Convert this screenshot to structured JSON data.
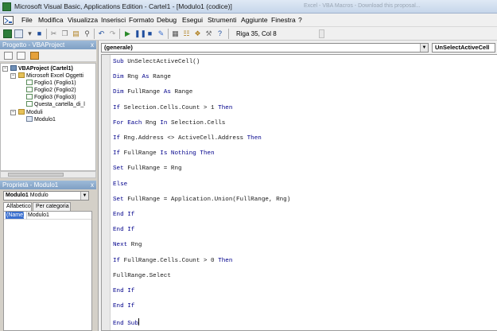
{
  "window": {
    "title": "Microsoft Visual Basic, Applications Edition - Cartel1 - [Modulo1 (codice)]",
    "ghost_title": "Excel - VBA Macros - Download this proposal..."
  },
  "menu": [
    "File",
    "Modifica",
    "Visualizza",
    "Inserisci",
    "Formato",
    "Debug",
    "Esegui",
    "Strumenti",
    "Aggiunte",
    "Finestra",
    "?"
  ],
  "toolbar": {
    "position": "Riga 35, Col 8"
  },
  "project_panel": {
    "title": "Progetto - VBAProject",
    "close": "x",
    "tree": [
      {
        "label": "VBAProject (Cartel1)",
        "type": "project"
      },
      {
        "label": "Microsoft Excel Oggetti",
        "type": "folder"
      },
      {
        "label": "Foglio1 (Foglio1)",
        "type": "sheet"
      },
      {
        "label": "Foglio2 (Foglio2)",
        "type": "sheet"
      },
      {
        "label": "Foglio3 (Foglio3)",
        "type": "sheet"
      },
      {
        "label": "Questa_cartella_di_l",
        "type": "sheet"
      },
      {
        "label": "Moduli",
        "type": "folder"
      },
      {
        "label": "Modulo1",
        "type": "module"
      }
    ]
  },
  "properties_panel": {
    "title": "Proprietà - Modulo1",
    "close": "x",
    "object_name": "Modulo1",
    "object_type": "Modulo",
    "tabs": [
      "Alfabetico",
      "Per categoria"
    ],
    "row_name": "(Name)",
    "row_value": "Modulo1"
  },
  "code_window": {
    "object_combo": "(generale)",
    "proc_combo": "UnSelectActiveCell",
    "lines": [
      {
        "kw1": "Sub",
        "rest": " UnSelectActiveCell()",
        "kw2": "",
        "tail": ""
      },
      {
        "kw1": "Dim",
        "rest": " Rng ",
        "kw2": "As",
        "tail": " Range"
      },
      {
        "kw1": "Dim",
        "rest": " FullRange ",
        "kw2": "As",
        "tail": " Range"
      },
      {
        "kw1": "If",
        "rest": " Selection.Cells.Count > 1 ",
        "kw2": "Then",
        "tail": ""
      },
      {
        "kw1": "For Each",
        "rest": " Rng ",
        "kw2": "In",
        "tail": " Selection.Cells"
      },
      {
        "kw1": "If",
        "rest": " Rng.Address <> ActiveCell.Address ",
        "kw2": "Then",
        "tail": ""
      },
      {
        "kw1": "If",
        "rest": " FullRange ",
        "kw2": "Is Nothing Then",
        "tail": ""
      },
      {
        "kw1": "Set",
        "rest": " FullRange = Rng",
        "kw2": "",
        "tail": ""
      },
      {
        "kw1": "Else",
        "rest": "",
        "kw2": "",
        "tail": ""
      },
      {
        "kw1": "Set",
        "rest": " FullRange = Application.Union(FullRange, Rng)",
        "kw2": "",
        "tail": ""
      },
      {
        "kw1": "End If",
        "rest": "",
        "kw2": "",
        "tail": ""
      },
      {
        "kw1": "End If",
        "rest": "",
        "kw2": "",
        "tail": ""
      },
      {
        "kw1": "Next",
        "rest": " Rng",
        "kw2": "",
        "tail": ""
      },
      {
        "kw1": "If",
        "rest": " FullRange.Cells.Count > 0 ",
        "kw2": "Then",
        "tail": ""
      },
      {
        "kw1": "",
        "rest": "FullRange.Select",
        "kw2": "",
        "tail": ""
      },
      {
        "kw1": "End If",
        "rest": "",
        "kw2": "",
        "tail": ""
      },
      {
        "kw1": "End If",
        "rest": "",
        "kw2": "",
        "tail": ""
      },
      {
        "kw1": "End Sub",
        "rest": "",
        "kw2": "",
        "tail": ""
      }
    ]
  }
}
